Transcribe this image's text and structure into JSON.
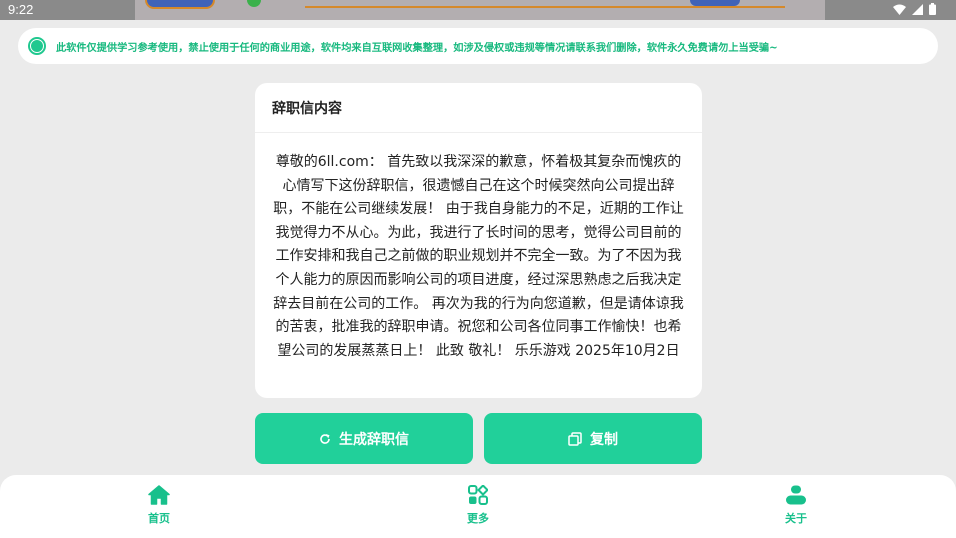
{
  "status_bar": {
    "time": "9:22",
    "icons": [
      "wifi-icon",
      "signal-icon",
      "battery-icon"
    ]
  },
  "notice": {
    "text": "此软件仅提供学习参考使用，禁止使用于任何的商业用途，软件均来自互联网收集整理，如涉及侵权或违规等情况请联系我们删除，软件永久免费请勿上当受骗~"
  },
  "card": {
    "title": "辞职信内容",
    "body": "尊敬的6ll.com： 首先致以我深深的歉意，怀着极其复杂而愧疚的心情写下这份辞职信，很遗憾自己在这个时候突然向公司提出辞职，不能在公司继续发展！ 由于我自身能力的不足，近期的工作让我觉得力不从心。为此，我进行了长时间的思考，觉得公司目前的工作安排和我自己之前做的职业规划并不完全一致。为了不因为我个人能力的原因而影响公司的项目进度，经过深思熟虑之后我决定辞去目前在公司的工作。 再次为我的行为向您道歉，但是请体谅我的苦衷，批准我的辞职申请。祝您和公司各位同事工作愉快！也希望公司的发展蒸蒸日上！ 此致 敬礼！ 乐乐游戏 2025年10月2日"
  },
  "buttons": {
    "generate": "生成辞职信",
    "copy": "复制"
  },
  "nav": {
    "home": "首页",
    "more": "更多",
    "about": "关于"
  },
  "colors": {
    "accent": "#21d09a",
    "accent_text": "#18b97f",
    "background": "#ebebeb"
  }
}
